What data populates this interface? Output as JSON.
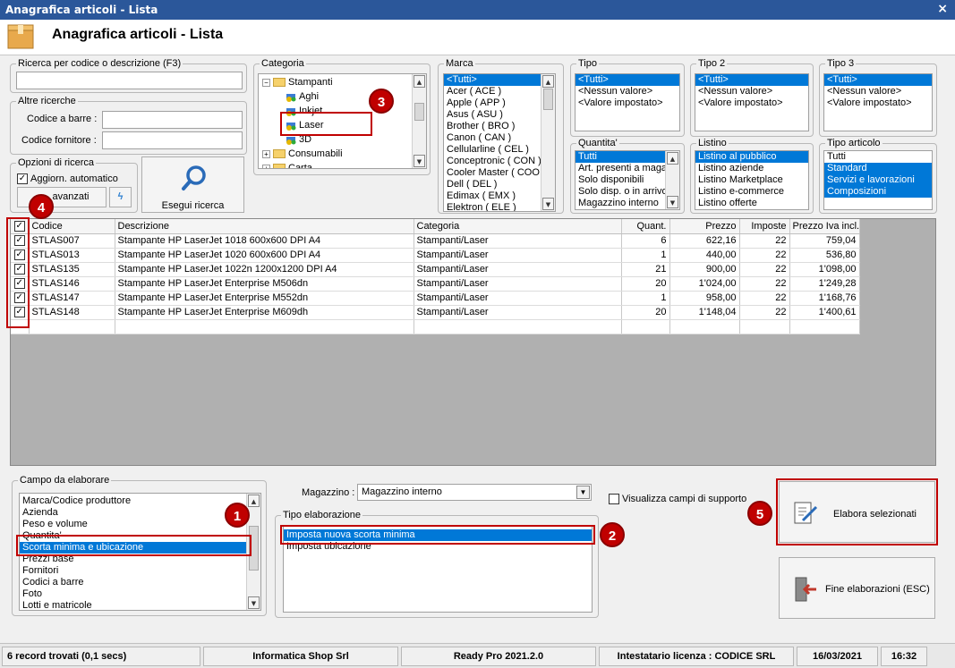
{
  "window": {
    "title": "Anagrafica articoli  - Lista",
    "heading": "Anagrafica articoli  - Lista"
  },
  "search": {
    "group_label": "Ricerca per codice o descrizione (F3)",
    "value": "",
    "other_label": "Altre ricerche",
    "barcode_label": "Codice a barre :",
    "supplier_label": "Codice fornitore :",
    "options_label": "Opzioni di ricerca",
    "auto_update_label": "Aggiorn. automatico",
    "advanced_label": "avanzati",
    "run_label": "Esegui ricerca"
  },
  "categoria": {
    "label": "Categoria",
    "items": [
      {
        "label": "Stampanti",
        "level": 0,
        "type": "folder",
        "expander": "−"
      },
      {
        "label": "Aghi",
        "level": 1,
        "type": "item"
      },
      {
        "label": "Inkjet",
        "level": 1,
        "type": "item"
      },
      {
        "label": "Laser",
        "level": 1,
        "type": "item",
        "selected": true
      },
      {
        "label": "3D",
        "level": 1,
        "type": "item"
      },
      {
        "label": "Consumabili",
        "level": 0,
        "type": "folder",
        "expander": "+"
      },
      {
        "label": "Carta",
        "level": 0,
        "type": "folder",
        "expander": "+"
      }
    ]
  },
  "marca": {
    "label": "Marca",
    "items": [
      "<Tutti>",
      "Acer ( ACE )",
      "Apple ( APP )",
      "Asus ( ASU )",
      "Brother ( BRO )",
      "Canon ( CAN )",
      "Cellularline ( CEL )",
      "Conceptronic ( CON )",
      "Cooler Master ( COO )",
      "Dell ( DEL )",
      "Edimax ( EMX )",
      "Elektron ( ELE )"
    ]
  },
  "tipo": {
    "label": "Tipo",
    "items": [
      "<Tutti>",
      "<Nessun valore>",
      "<Valore impostato>"
    ]
  },
  "tipo2": {
    "label": "Tipo 2",
    "items": [
      "<Tutti>",
      "<Nessun valore>",
      "<Valore impostato>"
    ]
  },
  "tipo3": {
    "label": "Tipo 3",
    "items": [
      "<Tutti>",
      "<Nessun valore>",
      "<Valore impostato>"
    ]
  },
  "quantita": {
    "label": "Quantita'",
    "items": [
      "Tutti",
      "Art. presenti a magazzino",
      "Solo disponibili",
      "Solo disp. o in arrivo",
      "Magazzino interno"
    ]
  },
  "listino": {
    "label": "Listino",
    "items": [
      "Listino al pubblico",
      "Listino aziende",
      "Listino Marketplace",
      "Listino e-commerce",
      "Listino offerte"
    ]
  },
  "tipo_articolo": {
    "label": "Tipo articolo",
    "items": [
      "Tutti",
      "Standard",
      "Servizi e lavorazioni",
      "Composizioni"
    ]
  },
  "grid": {
    "columns": [
      "Codice",
      "Descrizione",
      "Categoria",
      "Quant.",
      "Prezzo",
      "Imposte",
      "Prezzo Iva incl."
    ],
    "rows": [
      [
        "STLAS007",
        "Stampante HP LaserJet 1018 600x600 DPI A4",
        "Stampanti/Laser",
        "6",
        "622,16",
        "22",
        "759,04"
      ],
      [
        "STLAS013",
        "Stampante HP LaserJet 1020 600x600 DPI A4",
        "Stampanti/Laser",
        "1",
        "440,00",
        "22",
        "536,80"
      ],
      [
        "STLAS135",
        "Stampante HP LaserJet 1022n 1200x1200 DPI A4",
        "Stampanti/Laser",
        "21",
        "900,00",
        "22",
        "1'098,00"
      ],
      [
        "STLAS146",
        "Stampante HP LaserJet Enterprise M506dn",
        "Stampanti/Laser",
        "20",
        "1'024,00",
        "22",
        "1'249,28"
      ],
      [
        "STLAS147",
        "Stampante HP LaserJet Enterprise M552dn",
        "Stampanti/Laser",
        "1",
        "958,00",
        "22",
        "1'168,76"
      ],
      [
        "STLAS148",
        "Stampante HP LaserJet Enterprise M609dh",
        "Stampanti/Laser",
        "20",
        "1'148,04",
        "22",
        "1'400,61"
      ]
    ]
  },
  "campo": {
    "label": "Campo da elaborare",
    "items": [
      "Marca/Codice produttore",
      "Azienda",
      "Peso e volume",
      "Quantita'",
      "Scorta minima e ubicazione",
      "Prezzi base",
      "Fornitori",
      "Codici a barre",
      "Foto",
      "Lotti e matricole"
    ],
    "selected_index": 4
  },
  "magazzino": {
    "label": "Magazzino :",
    "value": "Magazzino interno"
  },
  "tipo_elaborazione": {
    "label": "Tipo elaborazione",
    "items": [
      "Imposta nuova scorta minima",
      "Imposta ubicazione"
    ]
  },
  "support_fields_label": "Visualizza campi di supporto",
  "process_button_label": "Elabora selezionati",
  "end_button_label": "Fine elaborazioni (ESC)",
  "badges": [
    "1",
    "2",
    "3",
    "4",
    "5"
  ],
  "status": {
    "records": "6 record trovati (0,1 secs)",
    "company": "Informatica Shop Srl",
    "version": "Ready Pro 2021.2.0",
    "license": "Intestatario licenza : CODICE SRL",
    "date": "16/03/2021",
    "time": "16:32"
  },
  "colors": {
    "accent": "#0078d7",
    "highlight": "#c00000",
    "titlebar": "#2b579a"
  }
}
